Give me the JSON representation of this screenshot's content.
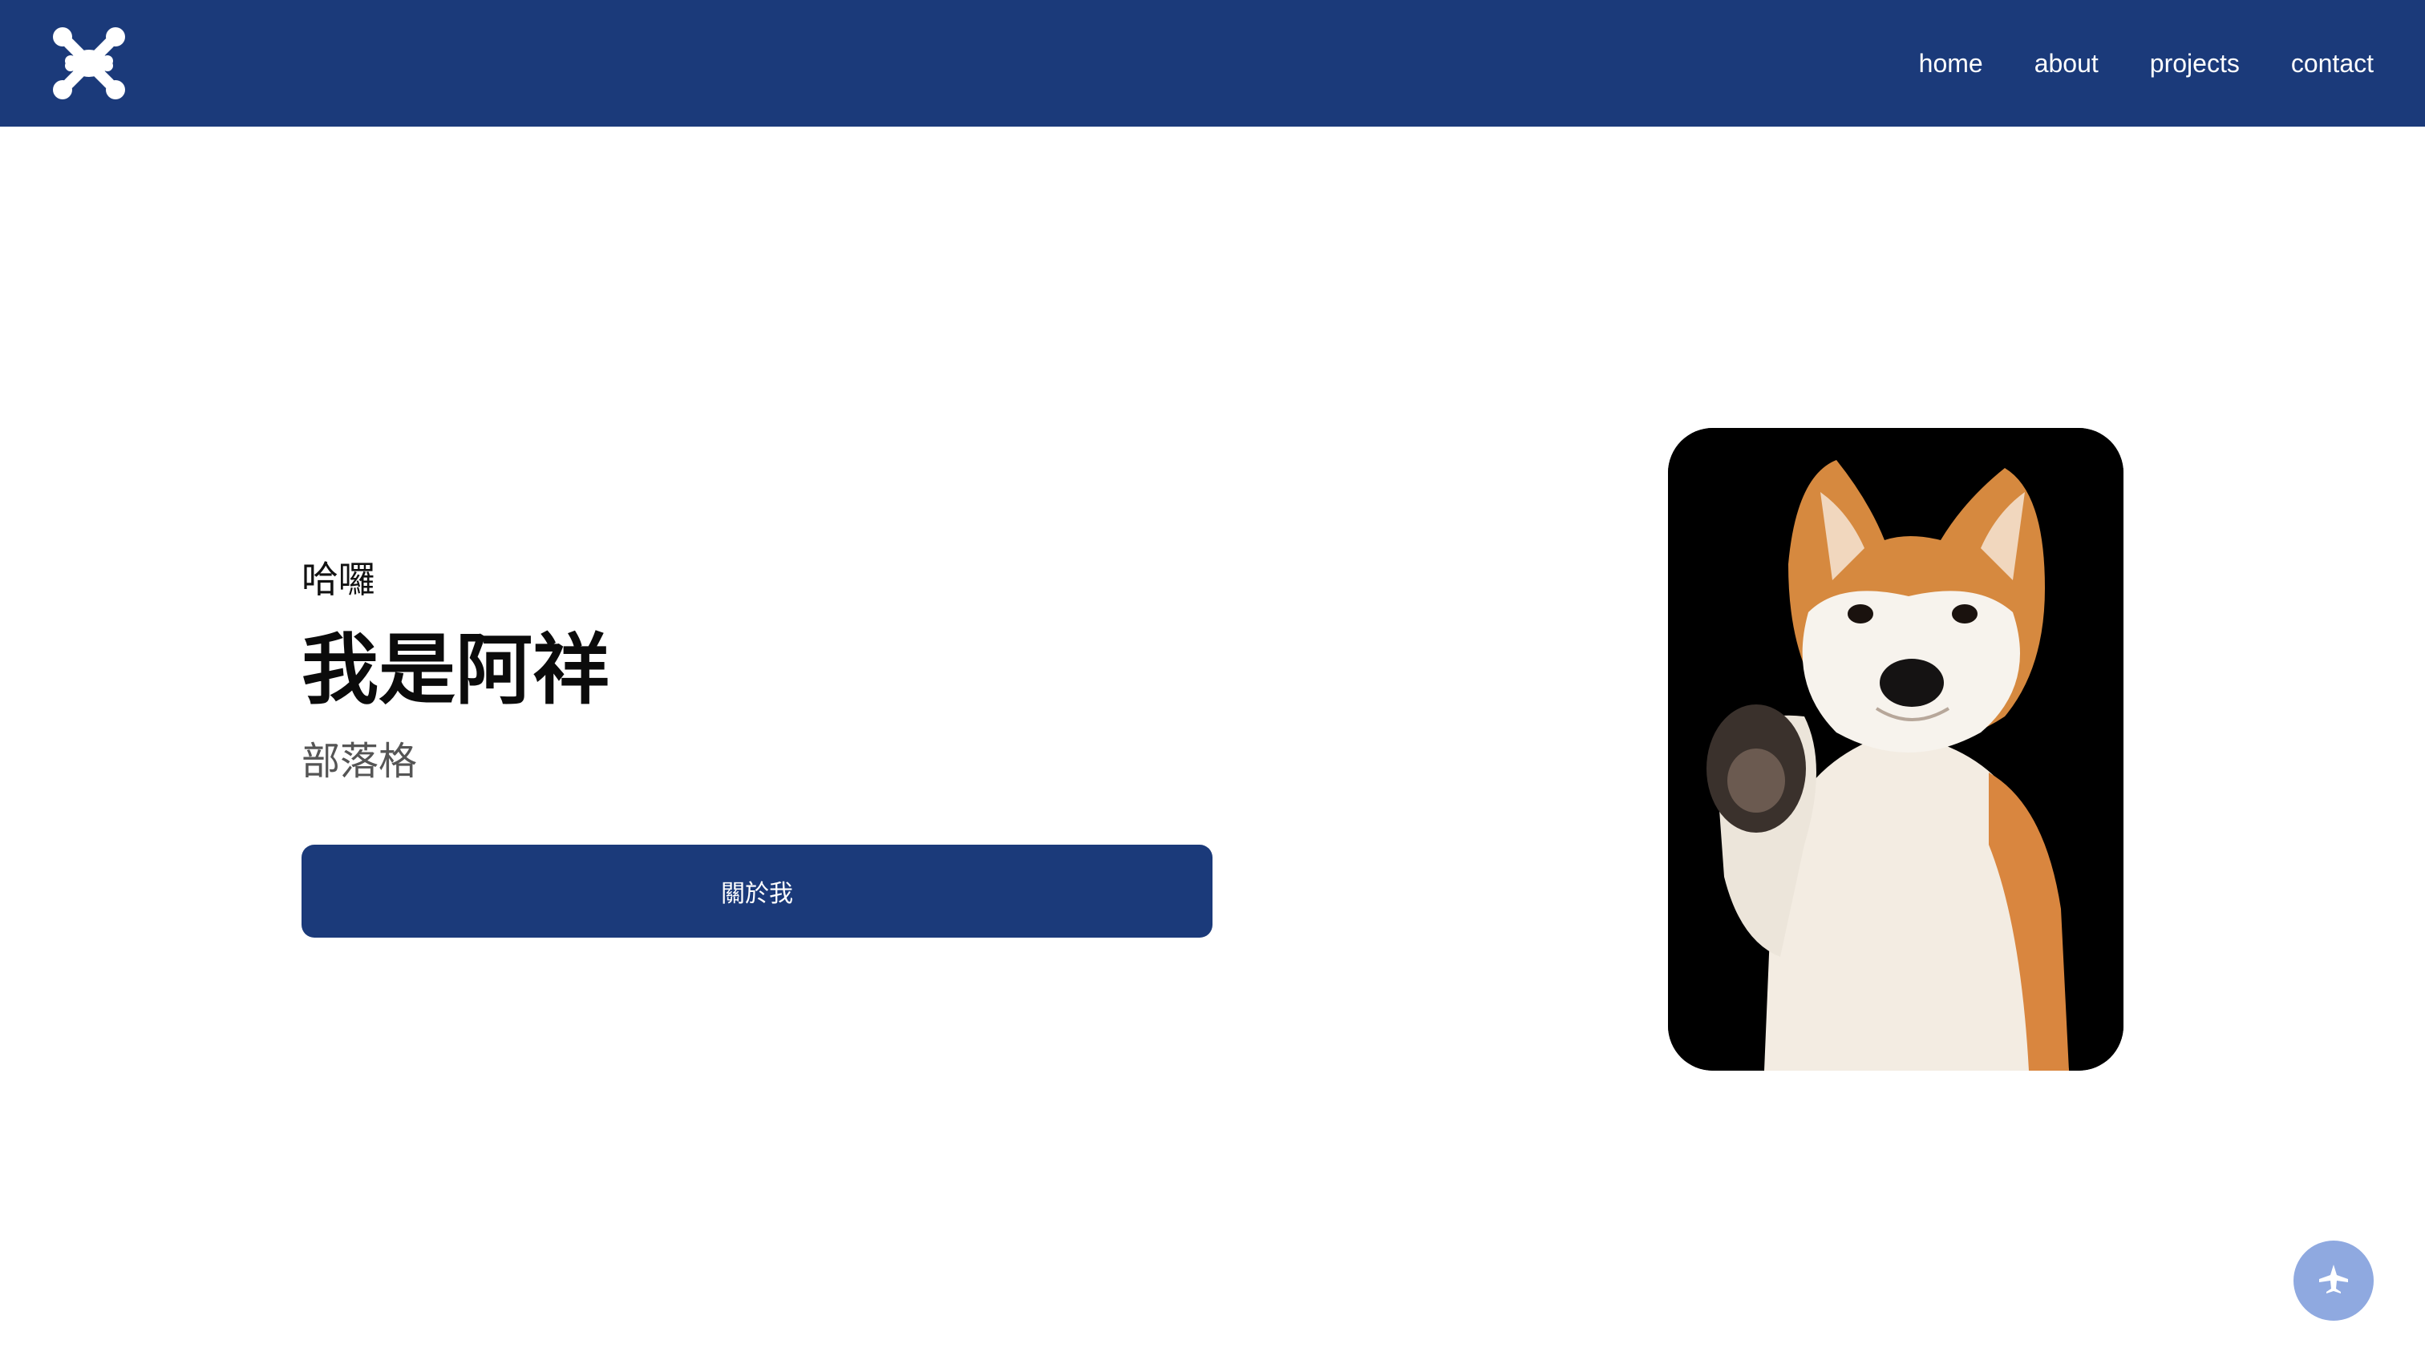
{
  "navbar": {
    "logo_icon": "joomla-logo-icon",
    "links": [
      {
        "label": "home"
      },
      {
        "label": "about"
      },
      {
        "label": "projects"
      },
      {
        "label": "contact"
      }
    ],
    "background_color": "#1b3a7a"
  },
  "hero": {
    "greeting": "哈囉",
    "name": "我是阿祥",
    "subtitle": "部落格",
    "button_label": "關於我",
    "photo_icon": "shiba-inu-photo"
  },
  "fab": {
    "icon": "airplane-icon",
    "color": "#8fa9e0"
  }
}
